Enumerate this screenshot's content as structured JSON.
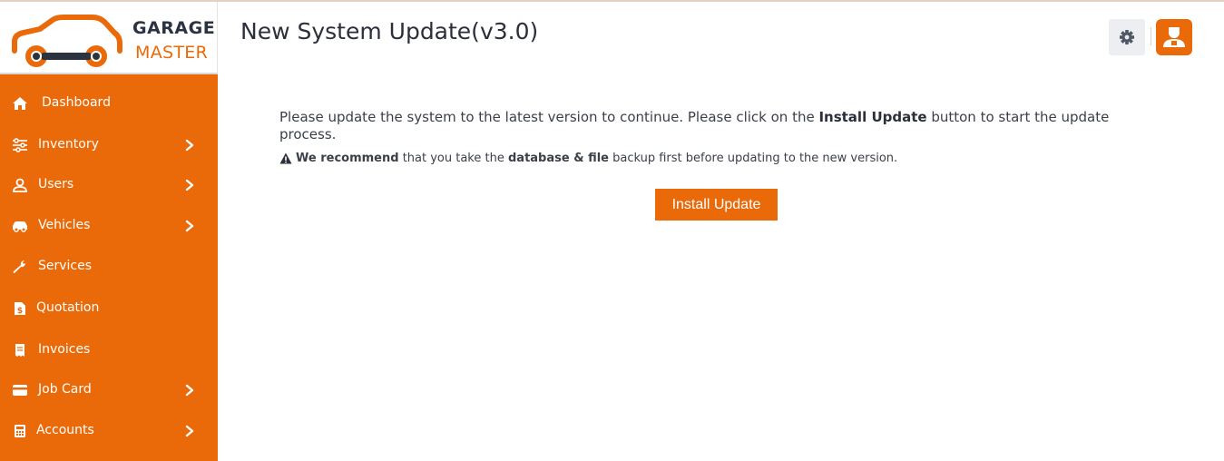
{
  "brand": {
    "line1": "GARAGE",
    "line2": "MASTER",
    "accent_color": "#ea6a0a",
    "logo_icon": "car-wrench-logo"
  },
  "header": {
    "title": "New System Update(v3.0)",
    "settings_icon": "gear-icon",
    "avatar_icon": "user-avatar-icon"
  },
  "sidebar": {
    "items": [
      {
        "label": "Dashboard",
        "icon": "home-icon",
        "has_submenu": false
      },
      {
        "label": "Inventory",
        "icon": "sliders-icon",
        "has_submenu": true
      },
      {
        "label": "Users",
        "icon": "user-icon",
        "has_submenu": true
      },
      {
        "label": "Vehicles",
        "icon": "car-icon",
        "has_submenu": true
      },
      {
        "label": "Services",
        "icon": "wrench-icon",
        "has_submenu": false
      },
      {
        "label": "Quotation",
        "icon": "file-dollar-icon",
        "has_submenu": false
      },
      {
        "label": "Invoices",
        "icon": "receipt-icon",
        "has_submenu": false
      },
      {
        "label": "Job Card",
        "icon": "credit-card-icon",
        "has_submenu": true
      },
      {
        "label": "Accounts",
        "icon": "calculator-icon",
        "has_submenu": true
      }
    ]
  },
  "content": {
    "msg_part1": "Please update the system to the latest version to continue. Please click on the ",
    "msg_bold": "Install Update",
    "msg_part2": " button to start the update process.",
    "warn_bold1": "We recommend",
    "warn_part1": " that you take the ",
    "warn_bold2": "database & file",
    "warn_part2": " backup first before updating to the new version.",
    "install_button": "Install Update"
  }
}
